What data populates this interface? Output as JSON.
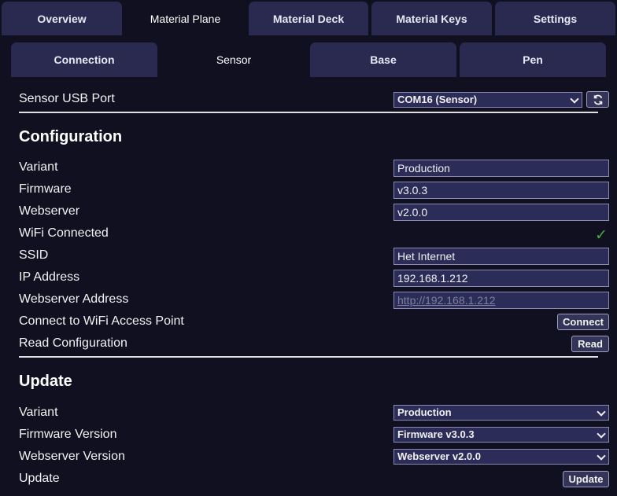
{
  "top_tabs": [
    {
      "label": "Overview",
      "active": false
    },
    {
      "label": "Material Plane",
      "active": true
    },
    {
      "label": "Material Deck",
      "active": false
    },
    {
      "label": "Material Keys",
      "active": false
    },
    {
      "label": "Settings",
      "active": false
    }
  ],
  "sub_tabs": [
    {
      "label": "Connection",
      "active": false
    },
    {
      "label": "Sensor",
      "active": true
    },
    {
      "label": "Base",
      "active": false
    },
    {
      "label": "Pen",
      "active": false
    }
  ],
  "sensor_port": {
    "label": "Sensor USB Port",
    "value": "COM16 (Sensor)",
    "refresh_icon": "refresh-icon"
  },
  "configuration": {
    "heading": "Configuration",
    "variant": {
      "label": "Variant",
      "value": "Production"
    },
    "firmware": {
      "label": "Firmware",
      "value": "v3.0.3"
    },
    "webserver": {
      "label": "Webserver",
      "value": "v2.0.0"
    },
    "wifi_connected": {
      "label": "WiFi Connected",
      "value": "✓"
    },
    "ssid": {
      "label": "SSID",
      "value": "Het Internet"
    },
    "ip_address": {
      "label": "IP Address",
      "value": "192.168.1.212"
    },
    "webserver_address": {
      "label": "Webserver Address",
      "value": "http://192.168.1.212"
    },
    "connect_wifi": {
      "label": "Connect to WiFi Access Point",
      "button": "Connect"
    },
    "read_config": {
      "label": "Read Configuration",
      "button": "Read"
    }
  },
  "update": {
    "heading": "Update",
    "variant": {
      "label": "Variant",
      "value": "Production"
    },
    "firmware_version": {
      "label": "Firmware Version",
      "value": "Firmware v3.0.3"
    },
    "webserver_version": {
      "label": "Webserver Version",
      "value": "Webserver v2.0.0"
    },
    "update": {
      "label": "Update",
      "button": "Update"
    }
  },
  "colors": {
    "background": "#101020",
    "tab_inactive": "#2a2a50",
    "field_bg": "#2c2c58",
    "check_green": "#3fae3f"
  }
}
